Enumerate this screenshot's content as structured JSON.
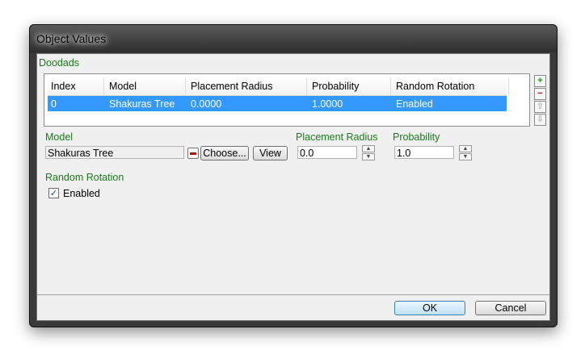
{
  "window": {
    "title": "Object Values"
  },
  "doodads": {
    "group_label": "Doodads",
    "columns": [
      "Index",
      "Model",
      "Placement Radius",
      "Probability",
      "Random Rotation"
    ],
    "rows": [
      {
        "index": "0",
        "model": "Shakuras Tree",
        "placement_radius": "0.0000",
        "probability": "1.0000",
        "random_rotation": "Enabled"
      }
    ],
    "side_buttons": [
      "plus-icon",
      "minus-icon",
      "arrow-up-icon",
      "arrow-down-icon"
    ]
  },
  "model": {
    "label": "Model",
    "value": "Shakuras Tree",
    "choose_label": "Choose...",
    "view_label": "View"
  },
  "placement_radius": {
    "label": "Placement Radius",
    "value": "0.0"
  },
  "probability": {
    "label": "Probability",
    "value": "1.0"
  },
  "random_rotation": {
    "label": "Random Rotation",
    "checkbox_label": "Enabled",
    "checked": true
  },
  "footer": {
    "ok_label": "OK",
    "cancel_label": "Cancel"
  },
  "colors": {
    "group_label": "#1a7a1a",
    "selection": "#3399ff"
  }
}
